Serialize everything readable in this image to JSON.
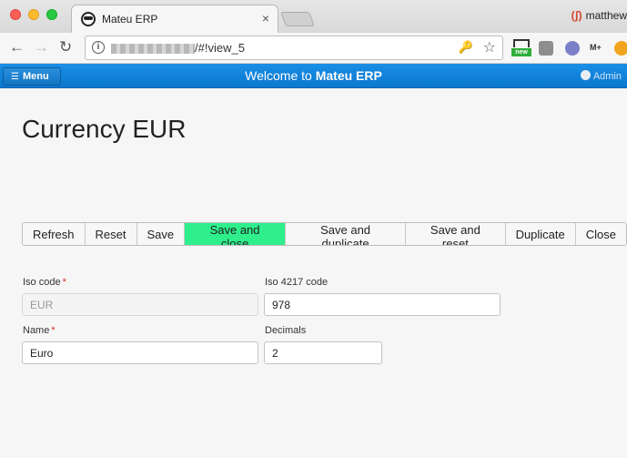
{
  "browser": {
    "tab_title": "Mateu ERP",
    "tab_close": "×",
    "profile_name": "matthew",
    "profile_symbol": "(ʃ)",
    "url_visible": "/#!view_5",
    "nav_back": "←",
    "nav_forward": "→",
    "nav_reload": "↻",
    "info": "i",
    "key_glyph": "🔑",
    "star_glyph": "☆",
    "ext_new_label": "new",
    "ext_m_label": "M+"
  },
  "app": {
    "menu_label": "Menu",
    "menu_glyph": "☰",
    "welcome_prefix": "Welcome to ",
    "welcome_app": "Mateu ERP",
    "user_label": "Admin",
    "colors": {
      "header": "#0a78cf",
      "primary_button": "#2eef8c",
      "required": "#d8281f"
    }
  },
  "page": {
    "title": "Currency EUR",
    "actions": [
      {
        "label": "Refresh"
      },
      {
        "label": "Reset"
      },
      {
        "label": "Save"
      },
      {
        "label": "Save and close",
        "primary": true
      },
      {
        "label": "Save and duplicate"
      },
      {
        "label": "Save and reset"
      },
      {
        "label": "Duplicate"
      },
      {
        "label": "Close"
      }
    ],
    "required_mark": "*",
    "fields": {
      "iso_code": {
        "label": "Iso code",
        "value": "EUR",
        "required": true,
        "disabled": true
      },
      "iso_4217": {
        "label": "Iso 4217 code",
        "value": "978"
      },
      "name": {
        "label": "Name",
        "value": "Euro",
        "required": true
      },
      "decimals": {
        "label": "Decimals",
        "value": "2"
      }
    }
  }
}
